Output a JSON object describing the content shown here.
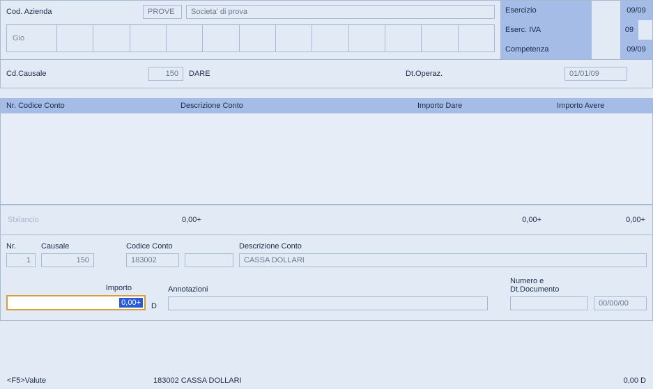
{
  "header": {
    "cod_azienda_label": "Cod. Azienda",
    "cod_azienda_value": "PROVE",
    "company_desc": "Societa' di prova",
    "gio_label": "Gio"
  },
  "exerc": {
    "esercizio_label": "Esercizio",
    "esercizio_value": "09/09",
    "iva_label": "Eserc. IVA",
    "iva_value": "09",
    "competenza_label": "Competenza",
    "competenza_value": "09/09"
  },
  "causale": {
    "label": "Cd.Causale",
    "value": "150",
    "desc": "DARE",
    "dt_label": "Dt.Operaz.",
    "dt_value": "01/01/09"
  },
  "table": {
    "cols": {
      "c1": "Nr. Codice Conto",
      "c2": "Descrizione Conto",
      "c3": "Importo Dare",
      "c4": "Importo Avere"
    }
  },
  "sbilancio": {
    "label": "Sbilancio",
    "v1": "0,00+",
    "v2": "0,00+",
    "v3": "0,00+"
  },
  "entry": {
    "nr_label": "Nr.",
    "nr_value": "1",
    "causale_label": "Causale",
    "causale_value": "150",
    "codice_conto_label": "Codice Conto",
    "codice_conto_value": "183002",
    "codice_conto_sub": "",
    "descr_label": "Descrizione Conto",
    "descr_value": "CASSA DOLLARI",
    "importo_label": "Importo",
    "importo_value": "0,00+",
    "d_flag": "D",
    "annotazioni_label": "Annotazioni",
    "annotazioni_value": "",
    "numdoc_label": "Numero e Dt.Documento",
    "numdoc_num": "",
    "numdoc_date": "00/00/00"
  },
  "footer": {
    "hint": "<F5>Valute",
    "center": "183002 CASSA DOLLARI",
    "right": "0,00 D"
  }
}
